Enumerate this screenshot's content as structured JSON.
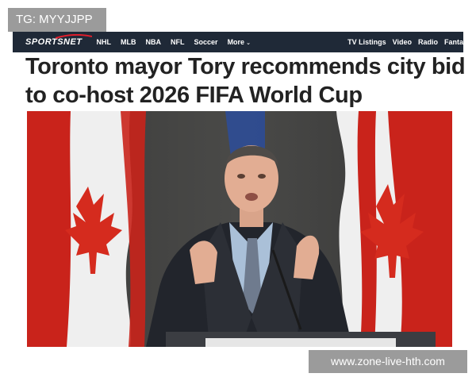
{
  "watermark": {
    "top_left": "TG: MYYJJPP",
    "bottom_right": "www.zone-live-hth.com"
  },
  "navbar": {
    "logo": "SPORTSNET",
    "left_items": [
      "NHL",
      "MLB",
      "NBA",
      "NFL",
      "Soccer"
    ],
    "more": "More",
    "right_items": [
      "TV Listings",
      "Video",
      "Radio",
      "Fanta"
    ]
  },
  "article": {
    "headline_line1": "Toronto mayor Tory recommends city bid",
    "headline_line2": "to co-host 2026 FIFA World Cup"
  },
  "colors": {
    "navbar_bg": "#1f2937",
    "flag_red": "#d52b1e",
    "headline": "#222222",
    "badge_bg": "#9b9b9b"
  }
}
